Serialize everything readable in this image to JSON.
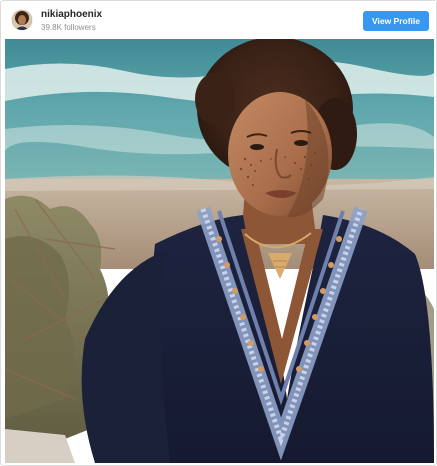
{
  "post": {
    "username": "nikiaphoenix",
    "followers": "39.8K followers",
    "view_profile_label": "View Profile",
    "avatar_icon": "profile-photo",
    "photo_subject": "portrait-photo"
  },
  "colors": {
    "button_bg": "#3897f0",
    "username_text": "#262626",
    "followers_text": "#8e8e8e",
    "border": "#dbdbdb"
  }
}
